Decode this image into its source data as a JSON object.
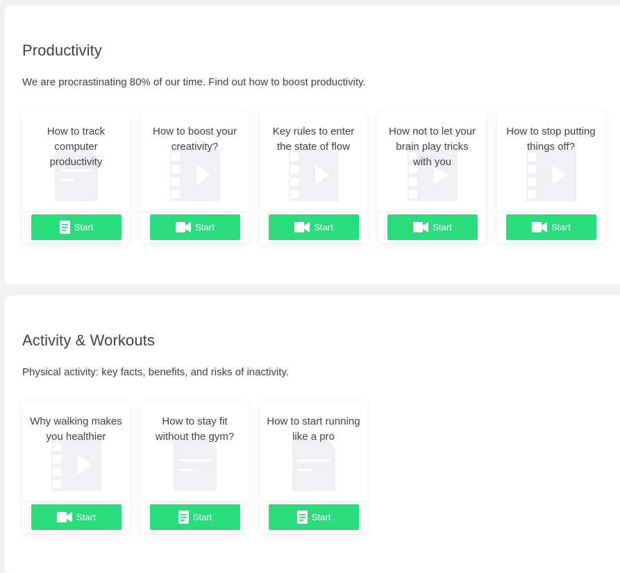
{
  "sections": [
    {
      "title": "Productivity",
      "description": "We are procrastinating 80% of our time. Find out how to boost productivity.",
      "cards": [
        {
          "title": "How to track computer productivity",
          "type": "document",
          "icon": "document-icon",
          "button_label": "Start"
        },
        {
          "title": "How to boost your creativity?",
          "type": "video",
          "icon": "video-camera-icon",
          "button_label": "Start"
        },
        {
          "title": "Key rules to enter the state of flow",
          "type": "video",
          "icon": "video-camera-icon",
          "button_label": "Start"
        },
        {
          "title": "How not to let your brain play tricks with you",
          "type": "video",
          "icon": "video-camera-icon",
          "button_label": "Start"
        },
        {
          "title": "How to stop putting things off?",
          "type": "video",
          "icon": "video-camera-icon",
          "button_label": "Start"
        }
      ]
    },
    {
      "title": "Activity & Workouts",
      "description": "Physical activity: key facts, benefits, and risks of inactivity.",
      "cards": [
        {
          "title": "Why walking makes you healthier",
          "type": "video",
          "icon": "video-camera-icon",
          "button_label": "Start"
        },
        {
          "title": "How to stay fit without the gym?",
          "type": "document",
          "icon": "document-icon",
          "button_label": "Start"
        },
        {
          "title": "How to start running like a pro",
          "type": "document",
          "icon": "document-icon",
          "button_label": "Start"
        }
      ]
    }
  ],
  "colors": {
    "accent": "#2bdc7f",
    "background": "#f0f1f3",
    "card": "#ffffff",
    "placeholder_art": "#eef0f4"
  }
}
